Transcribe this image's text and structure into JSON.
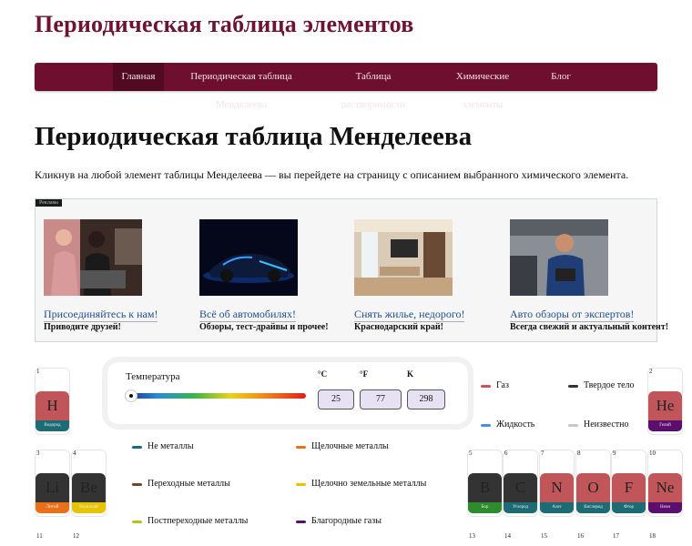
{
  "site": {
    "title": "Периодическая таблица элементов"
  },
  "nav": {
    "items": [
      {
        "label": "Главная",
        "active": true
      },
      {
        "label": "Периодическая таблица Менделеева",
        "active": false
      },
      {
        "label": "Таблица растворимости",
        "active": false
      },
      {
        "label": "Химические элементы",
        "active": false
      },
      {
        "label": "Блог",
        "active": false
      }
    ]
  },
  "main": {
    "title": "Периодическая таблица Менделеева",
    "intro": "Кликнув на любой элемент таблицы Менделеева — вы перейдете на страницу с описанием выбранного химического элемента."
  },
  "ads": {
    "label": "Реклама",
    "cards": [
      {
        "title": "Присоединяйтесь к нам!",
        "subtitle": "Приводите друзей!"
      },
      {
        "title": "Всё об автомобилях!",
        "subtitle": "Обзоры, тест-драйвы и прочее!"
      },
      {
        "title": "Снять жилье, недорого!",
        "subtitle": "Краснодарский край!"
      },
      {
        "title": "Авто обзоры от экспертов!",
        "subtitle": "Всегда свежий и актуальный контент!"
      }
    ]
  },
  "temperature": {
    "label": "Температура",
    "units": [
      "°C",
      "°F",
      "K"
    ],
    "values": [
      "25",
      "77",
      "298"
    ],
    "slider_fraction": 0.03
  },
  "state_legend": [
    {
      "label": "Газ",
      "color": "#c0565a"
    },
    {
      "label": "Твердое тело",
      "color": "#333333"
    },
    {
      "label": "Жидкость",
      "color": "#4b8fe0"
    },
    {
      "label": "Неизвестно",
      "color": "#c8c8c8"
    }
  ],
  "category_legend": [
    {
      "label": "Не металлы",
      "color": "#1d6b75"
    },
    {
      "label": "Щелочные металлы",
      "color": "#e8701a"
    },
    {
      "label": "Переходные металлы",
      "color": "#6b4a2a"
    },
    {
      "label": "Щелочно земельные металлы",
      "color": "#e8c400"
    },
    {
      "label": "Постпереходные металлы",
      "color": "#b5c41a"
    },
    {
      "label": "Благородные газы",
      "color": "#5a0f6e"
    }
  ],
  "elements": [
    {
      "number": "1",
      "symbol": "H",
      "name": "Водород",
      "tile": "#c0565a",
      "bar": "#1d6b75"
    },
    {
      "number": "2",
      "symbol": "He",
      "name": "Гелий",
      "tile": "#c0565a",
      "bar": "#5a0f6e"
    },
    {
      "number": "3",
      "symbol": "Li",
      "name": "Литий",
      "tile": "#333333",
      "bar": "#e8701a"
    },
    {
      "number": "4",
      "symbol": "Be",
      "name": "Бериллий",
      "tile": "#333333",
      "bar": "#e8c400"
    },
    {
      "number": "5",
      "symbol": "B",
      "name": "Бор",
      "tile": "#333333",
      "bar": "#2e8b2e"
    },
    {
      "number": "6",
      "symbol": "C",
      "name": "Углерод",
      "tile": "#333333",
      "bar": "#1d6b75"
    },
    {
      "number": "7",
      "symbol": "N",
      "name": "Азот",
      "tile": "#c0565a",
      "bar": "#1d6b75"
    },
    {
      "number": "8",
      "symbol": "O",
      "name": "Кислород",
      "tile": "#c0565a",
      "bar": "#1d6b75"
    },
    {
      "number": "9",
      "symbol": "F",
      "name": "Фтор",
      "tile": "#c0565a",
      "bar": "#1d6b75"
    },
    {
      "number": "10",
      "symbol": "Ne",
      "name": "Неон",
      "tile": "#c0565a",
      "bar": "#5a0f6e"
    }
  ],
  "next_row_numbers": [
    "11",
    "12",
    "13",
    "14",
    "15",
    "16",
    "17",
    "18"
  ]
}
